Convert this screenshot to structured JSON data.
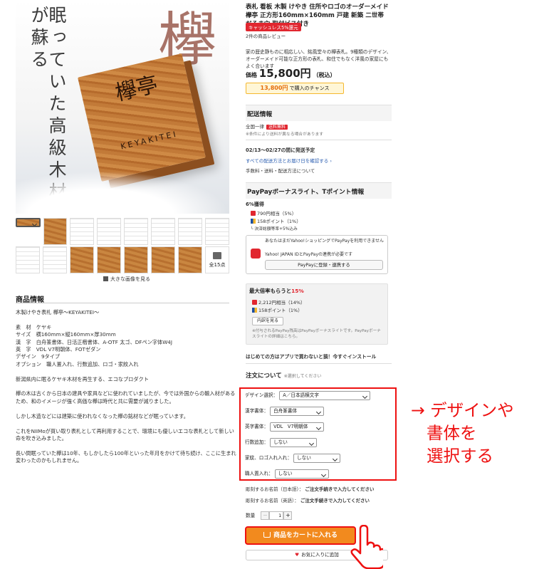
{
  "hero": {
    "big_kanji": "欅",
    "vertical_text": "眠っていた高級木材が蘇る",
    "block_kanji": "欅亭",
    "block_roman": "KEYAKITEI"
  },
  "gallery": {
    "more_count": "全15点",
    "zoom_link": "大きな画像を見る",
    "row2_labels": [
      "欅亭",
      "欅",
      "欅",
      "欅",
      "欅",
      "欅"
    ]
  },
  "product_info": {
    "heading": "商品情報",
    "body": "木製けやき表札 欅亭〜KEYAKITEI〜\n\n素　材　ケヤキ\nサイズ　横160mm×縦160mm×厚30mm\n漢　字　白舟篆書体、日活正楷書体、A-OTF 太ゴ、DFペン字体W4J\n英　字　VDL V7明朝体、FOTゼダン\nデザイン　9タイプ\nオプション　職人置入れ、行数追加、ロゴ・家紋入れ\n\n新潟県内に眠るケヤキ木材を再生する、エコなプロダクト\n\n欅の木は古くから日本の建具や家具などに使われていましたが、今では外国からの輸入材があるため、和のイメージが強く高価な欅は時代と共に需要が減りました。\n\nしかし木造などには建築に使われなくなった欅の銘材などが眠っています。\n\nこれをNIIMoが買い取り表札として再利用することで、環境にも優しいエコな表札として新しい命を吹き込みました。\n\n長い間眠っていた欅は10年、もしかしたら100年といった年月をかけて待ち続け、ここに生まれ変わったのかもしれません。"
  },
  "product": {
    "title": "表札 看板 木製 けやき 住所やロゴのオーダーメイド 欅亭 正方形160mm×160mm 戸建 新築 二世帯 だるま穴 取付ビス付き",
    "cashless_badge": "キャッシュレス5%還元",
    "reviews": "2件の商品レビュー",
    "description": "家の歴史静ものに相応しい、銘風堂々の欅表札。9種類のデザイン、オーダーメイド可能な正方形の表札、和住でもなく洋風の家屋にもよく合います",
    "price_label": "価格",
    "price_value": "15,800円",
    "price_tax": "（税込）",
    "chance_price": "13,800円",
    "chance_suffix": "で購入のチャンス"
  },
  "shipping": {
    "heading": "配送情報",
    "region": "全国一律",
    "free_tag": "送料無料",
    "note": "※条件により送料が異なる場合があります",
    "eta": "02/13〜02/27の間に発送予定",
    "methods_link": "すべての配送方法とお届け日を確認する ›",
    "fees_link": "手数料・送料・配送方法について"
  },
  "points": {
    "heading": "PayPayボーナスライト、Tポイント情報",
    "rate": "6%獲得",
    "paypay": "790円相当（5%）",
    "tpoint": "158ポイント（1%）",
    "detail": "└ 決済総額等率+5%込み",
    "box_line1": "あなたはまだYahoo!ショッピングでPayPayを利用できません",
    "box_line2": "Yahoo! JAPAN IDとPayPayの連携が必要です",
    "box_button": "PayPayに登録・連携する"
  },
  "max_points": {
    "title_prefix": "最大倍率もらうと",
    "title_rate": "15%",
    "paypay": "2,212円相当（14%）",
    "tpoint": "158ポイント（1%）",
    "detail_button": "内訳を見る",
    "note": "※付与されるPayPay残高はPayPayボーナスライトです。PayPayボーナスライトの詳細はこちら。"
  },
  "app_banner": "はじめての方はアプリで買わないと損！今すぐインストール",
  "order": {
    "heading": "注文について",
    "required": "※選択してください",
    "options": [
      {
        "label": "デザイン選択：",
        "value": "A／日本語横文字"
      },
      {
        "label": "漢字書体：",
        "value": "白舟篆書体"
      },
      {
        "label": "英字書体：",
        "value": "VDL　V7明朝体"
      },
      {
        "label": "行数追加：",
        "value": "しない"
      },
      {
        "label": "家紋、ロゴ入れ入れ：",
        "value": "しない"
      },
      {
        "label": "職人置入れ：",
        "value": "しない"
      }
    ],
    "engrave_jp_label": "彫刻するお名前（日本語）：",
    "engrave_jp_value": "ご注文手続きで入力してください",
    "engrave_en_label": "彫刻するお名前（英語）：",
    "engrave_en_value": "ご注文手続きで入力してください",
    "qty_label": "数量",
    "qty_value": "1"
  },
  "annotation": [
    "→ デザインや",
    "書体を",
    "選択する"
  ],
  "buttons": {
    "cart": "商品をカートに入れる",
    "favorite": "お気に入りに追加"
  }
}
